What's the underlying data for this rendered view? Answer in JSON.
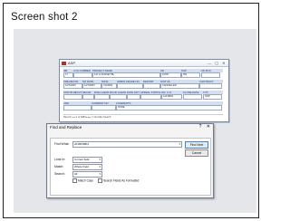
{
  "caption": "Screen shot 2",
  "form_window": {
    "title": "ASP",
    "controls": "—  ▢  ✕",
    "row1": [
      {
        "label": "MB",
        "value": "17"
      },
      {
        "label": "LOG NUMBER",
        "value": ""
      },
      {
        "label": "PROJECT NAME",
        "value": "147 H SUNSET BL"
      },
      {
        "label": "CD",
        "value": "16787"
      },
      {
        "label": "SAP",
        "value": "001"
      },
      {
        "label": "CD PCS",
        "value": ""
      }
    ],
    "row2": [
      {
        "label": "PRE RECVD",
        "value": "1/27/2003"
      },
      {
        "label": "NO DATE",
        "value": "1/27/2003"
      },
      {
        "label": "NO/M",
        "value": "7/2/2003"
      },
      {
        "label": "ADMIN GRADE NO",
        "value": ""
      },
      {
        "label": "REPORT",
        "value": ""
      },
      {
        "label": "STATUS",
        "value": "CANCELLED"
      },
      {
        "label": "CONTRACT",
        "value": ""
      }
    ],
    "row3": [
      {
        "label": "CONTR RECV'D",
        "value": ""
      },
      {
        "label": "REVLR",
        "value": ""
      },
      {
        "label": "DUE CLIENT",
        "value": ""
      },
      {
        "label": "RCVD CLIENT",
        "value": ""
      },
      {
        "label": "DATE NOT",
        "value": ""
      },
      {
        "label": "APPEAL STATUS",
        "value": ""
      },
      {
        "label": "INV. C.O.",
        "value": "123.6B04"
      },
      {
        "label": "CLOSE DATE",
        "value": ""
      },
      {
        "label": "TYP",
        "value": "ODP"
      }
    ],
    "row4": [
      {
        "label": "CDE",
        "value": ""
      },
      {
        "label": "CURRENT NO",
        "value": ""
      },
      {
        "label": "COMMENTS",
        "value": "NONE"
      }
    ],
    "nav": "Record: ◂ ◂  1 of 3083  ▸ ▸▸  ✕ No Filter   Search"
  },
  "find_dialog": {
    "title": "Find and Replace",
    "help": "?",
    "close": "✕",
    "tabs": [
      "Find",
      "Replace"
    ],
    "find_what_label": "Find What:",
    "find_what_value": "20180188(2",
    "look_in_label": "Look In:",
    "look_in_value": "Current field",
    "match_label": "Match:",
    "match_value": "Whole Field",
    "search_label": "Search:",
    "search_value": "All",
    "match_case_label": "Match Case",
    "search_formatted_label": "Search Fields As Formatted",
    "find_next_label": "Find Next",
    "cancel_label": "Cancel"
  }
}
